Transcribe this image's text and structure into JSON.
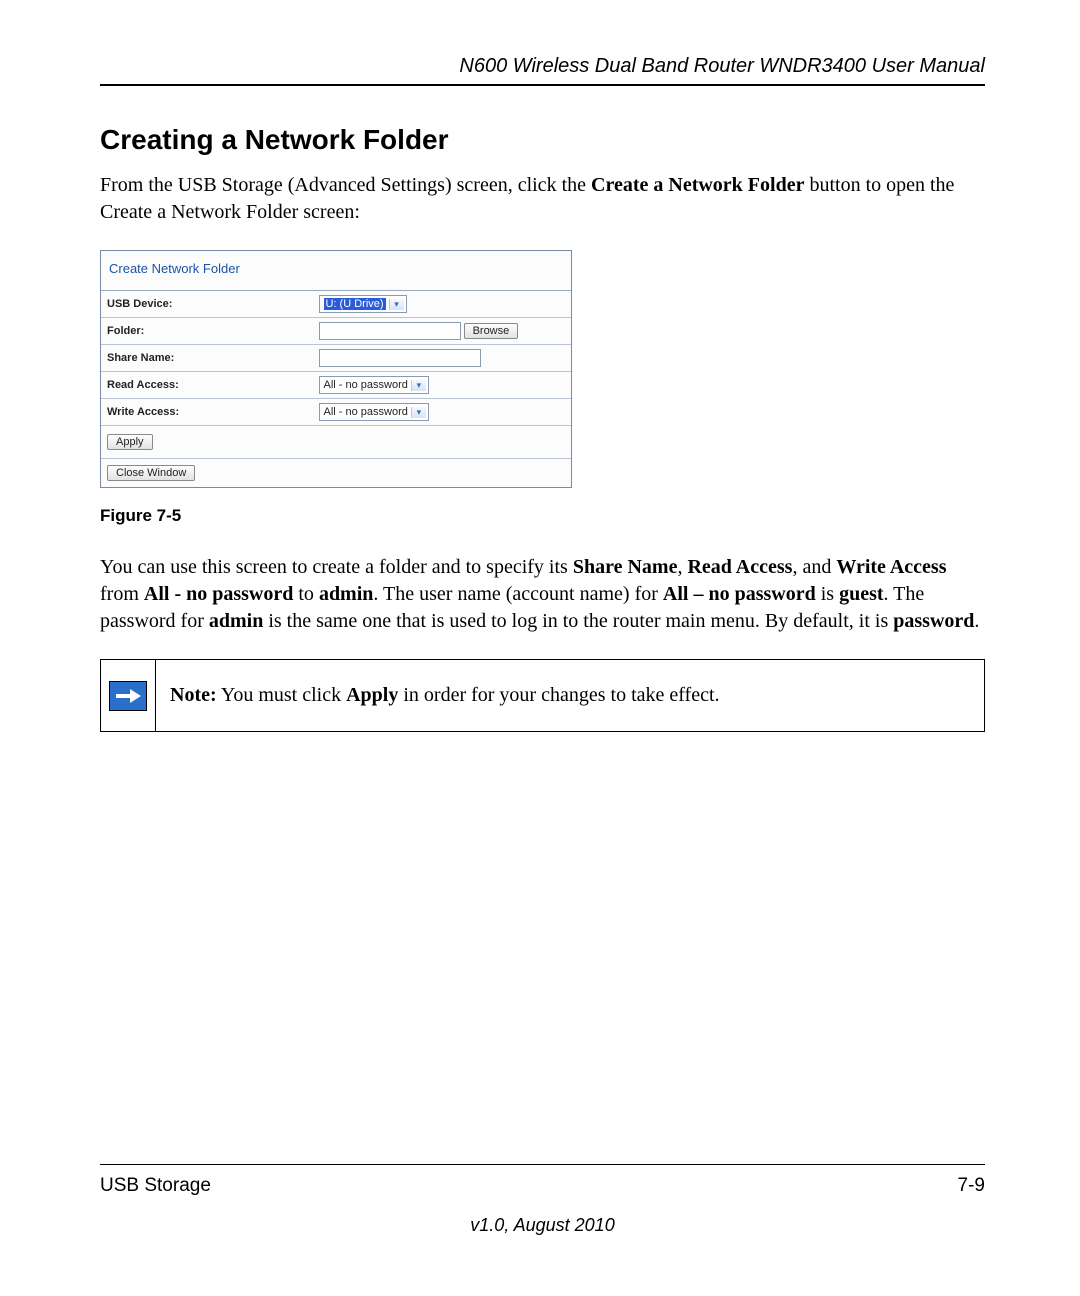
{
  "header": {
    "doc_title": "N600 Wireless Dual Band Router WNDR3400 User Manual"
  },
  "section": {
    "heading": "Creating a Network Folder",
    "intro_pre": "From the USB Storage (Advanced Settings) screen, click the ",
    "intro_bold": "Create a Network Folder",
    "intro_post": " button to open the Create a Network Folder screen:"
  },
  "screenshot": {
    "title": "Create Network Folder",
    "rows": {
      "usb_device_label": "USB Device:",
      "usb_device_value": "U: (U Drive)",
      "folder_label": "Folder:",
      "browse_btn": "Browse",
      "share_name_label": "Share Name:",
      "read_access_label": "Read Access:",
      "read_access_value": "All - no password",
      "write_access_label": "Write Access:",
      "write_access_value": "All - no password"
    },
    "apply_btn": "Apply",
    "close_btn": "Close Window"
  },
  "figure_caption": "Figure 7-5",
  "para2": {
    "t1": "You can use this screen to create a folder and to specify its ",
    "b1": "Share Name",
    "t2": ", ",
    "b2": "Read Access",
    "t3": ", and ",
    "b3": "Write Access",
    "t4": " from ",
    "b4": "All - no password",
    "t5": " to ",
    "b5": "admin",
    "t6": ". The user name (account name) for ",
    "b6": "All – no password",
    "t7": " is ",
    "b7": "guest",
    "t8": ". The password for ",
    "b8": "admin",
    "t9": " is the same one that is used to log in to the router main menu. By default, it is ",
    "b9": "password",
    "t10": "."
  },
  "note": {
    "label": "Note:",
    "text_pre": " You must click ",
    "text_bold": "Apply",
    "text_post": " in order for your changes to take effect."
  },
  "footer": {
    "left": "USB Storage",
    "right": "7-9",
    "version": "v1.0, August 2010"
  }
}
